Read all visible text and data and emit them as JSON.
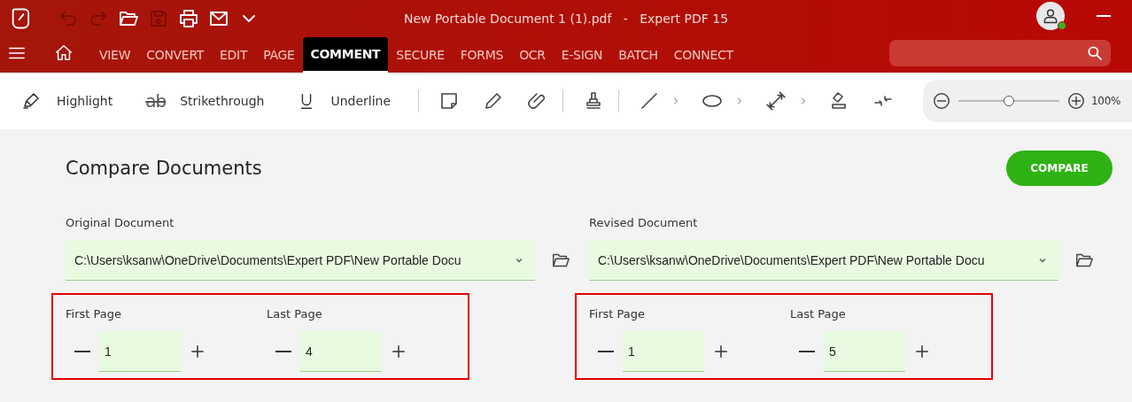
{
  "window": {
    "title": "New Portable Document 1 (1).pdf   -   Expert PDF 15"
  },
  "quick_access": [
    {
      "kind": "undo",
      "disabled": true
    },
    {
      "kind": "redo",
      "disabled": true
    },
    {
      "kind": "open",
      "disabled": false
    },
    {
      "kind": "save",
      "disabled": true
    },
    {
      "kind": "print",
      "disabled": false
    },
    {
      "kind": "mail",
      "disabled": false
    },
    {
      "kind": "more",
      "disabled": false
    }
  ],
  "tabs": [
    {
      "label": "VIEW",
      "selected": false
    },
    {
      "label": "CONVERT",
      "selected": false
    },
    {
      "label": "EDIT",
      "selected": false
    },
    {
      "label": "PAGE",
      "selected": false
    },
    {
      "label": "COMMENT",
      "selected": true
    },
    {
      "label": "SECURE",
      "selected": false
    },
    {
      "label": "FORMS",
      "selected": false
    },
    {
      "label": "OCR",
      "selected": false
    },
    {
      "label": "E-SIGN",
      "selected": false
    },
    {
      "label": "BATCH",
      "selected": false
    },
    {
      "label": "CONNECT",
      "selected": false
    }
  ],
  "toolbar": {
    "text_tools": [
      {
        "kind": "highlight",
        "label": "Highlight"
      },
      {
        "kind": "strikethrough",
        "label": "Strikethrough",
        "glyph": "ab"
      },
      {
        "kind": "underline",
        "label": "Underline"
      }
    ],
    "zoom": {
      "level": 0.5,
      "reading": "100%"
    }
  },
  "compare": {
    "title": "Compare Documents",
    "button": "COMPARE",
    "documents": [
      {
        "label": "Original Document",
        "path": "C:\\Users\\ksanw\\OneDrive\\Documents\\Expert PDF\\New Portable Docu",
        "first_page_label": "First Page",
        "first_page": "1",
        "last_page_label": "Last Page",
        "last_page": "4"
      },
      {
        "label": "Revised Document",
        "path": "C:\\Users\\ksanw\\OneDrive\\Documents\\Expert PDF\\New Portable Docu",
        "first_page_label": "First Page",
        "first_page": "1",
        "last_page_label": "Last Page",
        "last_page": "5"
      }
    ]
  }
}
